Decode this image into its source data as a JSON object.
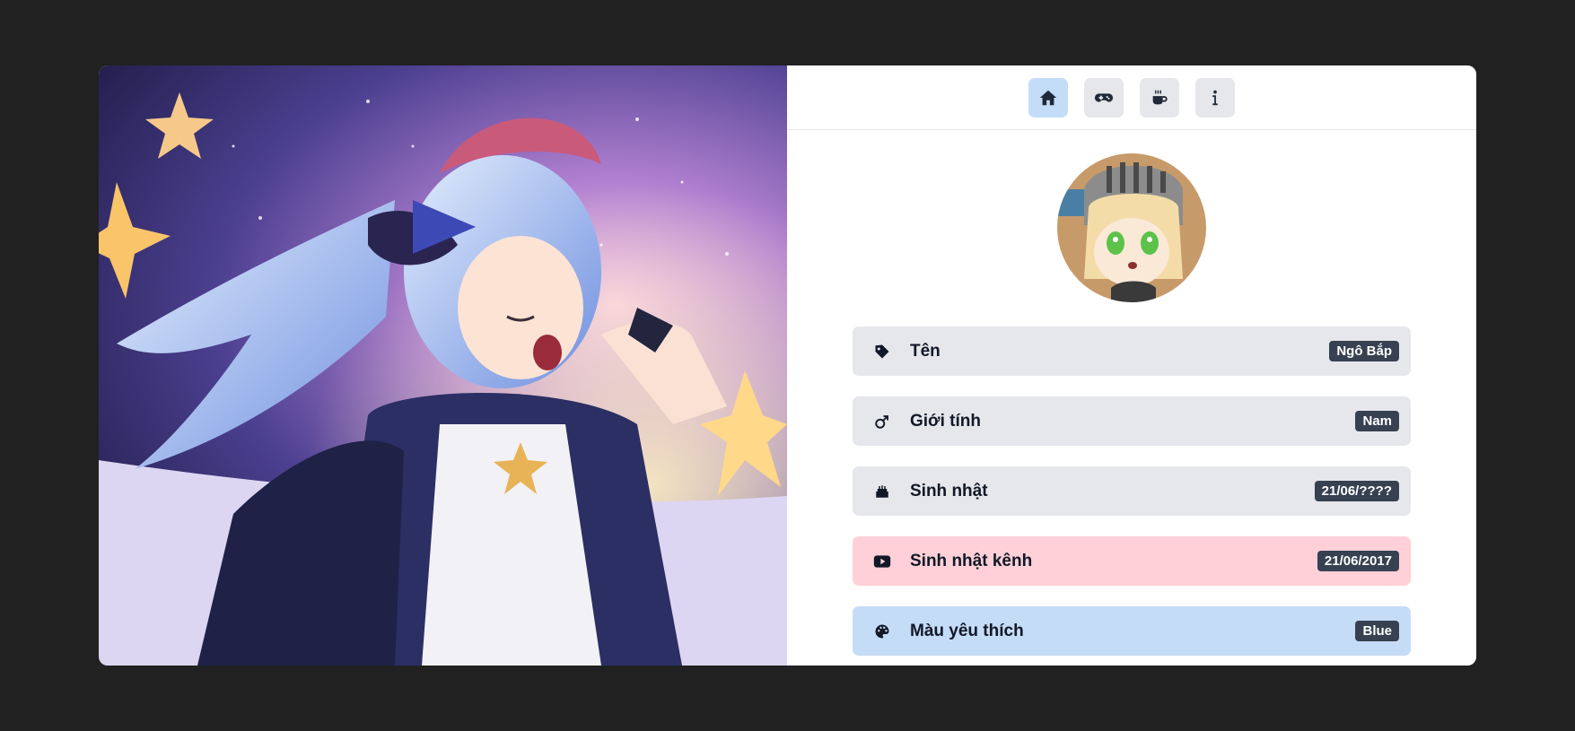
{
  "nav": {
    "items": [
      {
        "icon": "home-icon",
        "active": true
      },
      {
        "icon": "gamepad-icon",
        "active": false
      },
      {
        "icon": "coffee-icon",
        "active": false
      },
      {
        "icon": "info-icon",
        "active": false
      }
    ]
  },
  "profile": {
    "rows": [
      {
        "icon": "tag-icon",
        "label": "Tên",
        "value": "Ngô Bắp",
        "color": "#e5e7eb"
      },
      {
        "icon": "male-icon",
        "label": "Giới tính",
        "value": "Nam",
        "color": "#e5e7eb"
      },
      {
        "icon": "cake-icon",
        "label": "Sinh nhật",
        "value": "21/06/????",
        "color": "#e5e7eb"
      },
      {
        "icon": "youtube-icon",
        "label": "Sinh nhật kênh",
        "value": "21/06/2017",
        "color": "#ffd0d8"
      },
      {
        "icon": "palette-icon",
        "label": "Màu yêu thích",
        "value": "Blue",
        "color": "#c5dcf7"
      }
    ]
  },
  "colors": {
    "page_bg": "#212121",
    "active_nav": "#c3dcf8",
    "badge_bg": "#374151"
  }
}
